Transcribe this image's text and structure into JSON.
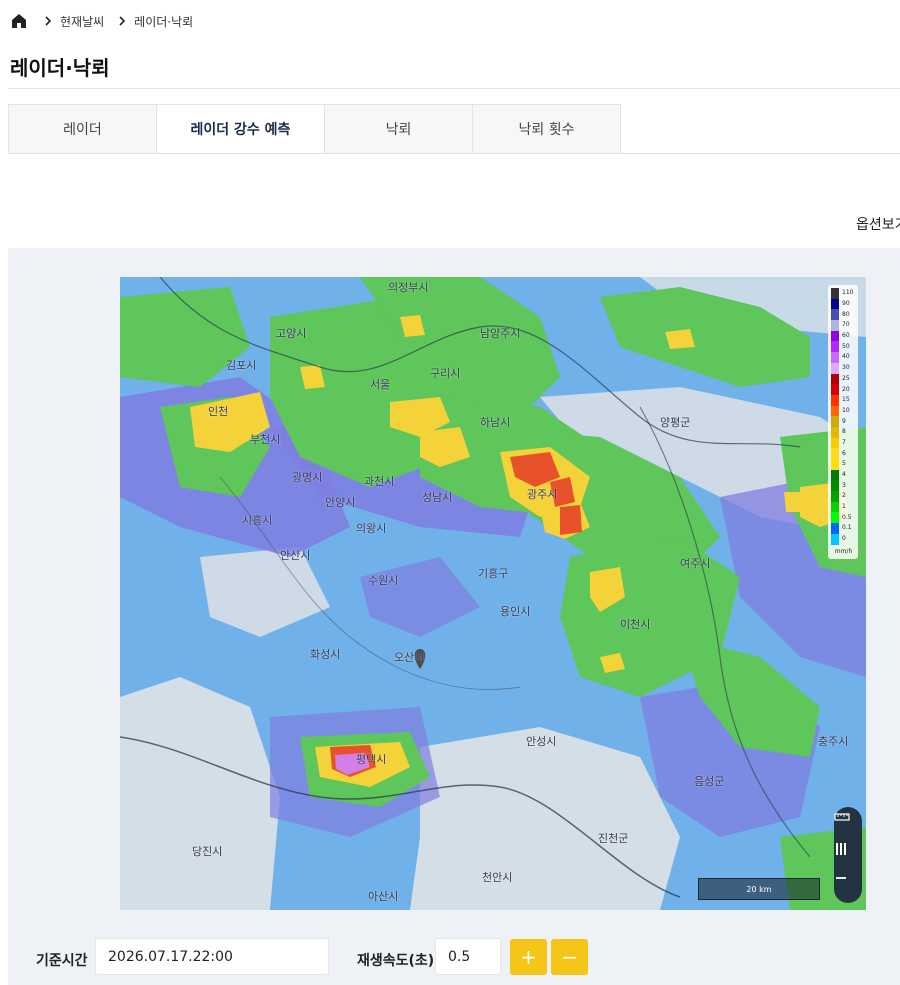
{
  "breadcrumb": {
    "items": [
      "현재날씨",
      "레이더·낙뢰"
    ]
  },
  "page": {
    "title": "레이더·낙뢰"
  },
  "tabs": [
    {
      "label": "레이더",
      "active": false
    },
    {
      "label": "레이더 강수 예측",
      "active": true
    },
    {
      "label": "낙뢰",
      "active": false
    },
    {
      "label": "낙뢰 횟수",
      "active": false
    }
  ],
  "options_link": "옵션보기",
  "map": {
    "place_labels": [
      "의정부시",
      "고양시",
      "남양주시",
      "김포시",
      "구리시",
      "서울",
      "인천",
      "하남시",
      "부천시",
      "양평군",
      "광명시",
      "과천시",
      "성남시",
      "광주시",
      "안양시",
      "시흥시",
      "의왕시",
      "안산시",
      "수원시",
      "기흥구",
      "용인시",
      "여주시",
      "이천시",
      "화성시",
      "오산시",
      "안성시",
      "충주시",
      "평택시",
      "음성군",
      "진천군",
      "당진시",
      "천안시",
      "아산시"
    ],
    "legend": {
      "values": [
        "110",
        "90",
        "80",
        "70",
        "60",
        "50",
        "40",
        "30",
        "25",
        "20",
        "15",
        "10",
        "9",
        "8",
        "7",
        "6",
        "5",
        "4",
        "3",
        "2",
        "1",
        "0.5",
        "0.1",
        "0"
      ],
      "colors": [
        "#333333",
        "#000390",
        "#4c4eb1",
        "#b3b4de",
        "#9300e4",
        "#b229ff",
        "#c969ff",
        "#e0a9ff",
        "#b40000",
        "#d20000",
        "#ff3200",
        "#ff6600",
        "#ccaa00",
        "#e0b900",
        "#f9cd00",
        "#ffdc1f",
        "#ffe100",
        "#007d00",
        "#008c00",
        "#00a400",
        "#00d500",
        "#00ff00",
        "#0064ff",
        "#00c7ff"
      ],
      "unit": "mm/h"
    },
    "scale_label": "20 km",
    "colors": {
      "base_blue": "#6fb1e8",
      "purple": "#7f7ee0",
      "green": "#5ec65a",
      "yellow": "#f4d23a",
      "red": "#e8522a",
      "land": "#dfe3e6"
    }
  },
  "controls": {
    "base_time_label": "기준시간",
    "base_time_value": "2026.07.17.22:00",
    "speed_label": "재생속도(초)",
    "speed_value": "0.5",
    "plus_label": "+",
    "minus_label": "−",
    "accent": "#f5c518"
  }
}
